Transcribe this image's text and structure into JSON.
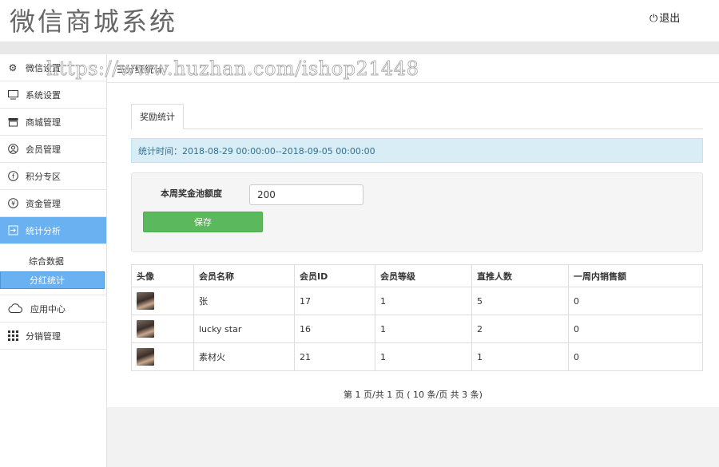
{
  "brand": "微信商城系统",
  "header": {
    "logout_label": "退出"
  },
  "sidebar": {
    "items": [
      {
        "label": "微信设置",
        "icon": "gear-icon"
      },
      {
        "label": "系统设置",
        "icon": "monitor-icon"
      },
      {
        "label": "商城管理",
        "icon": "store-icon"
      },
      {
        "label": "会员管理",
        "icon": "user-circle-icon"
      },
      {
        "label": "积分专区",
        "icon": "coin-icon"
      },
      {
        "label": "资金管理",
        "icon": "yen-icon"
      },
      {
        "label": "统计分析",
        "icon": "export-icon"
      }
    ],
    "subitems": [
      {
        "label": "综合数据"
      },
      {
        "label": "分红统计"
      }
    ],
    "extra": [
      {
        "label": "应用中心",
        "icon": "cloud-icon"
      },
      {
        "label": "分销管理",
        "icon": "grid-icon"
      }
    ]
  },
  "breadcrumb": "分红统计",
  "tabs": [
    {
      "label": "奖励统计"
    }
  ],
  "stat_time": "统计时间：2018-08-29 00:00:00--2018-09-05 00:00:00",
  "form": {
    "label": "本周奖金池额度",
    "value": "200",
    "save_label": "保存"
  },
  "table": {
    "headers": [
      "头像",
      "会员名称",
      "会员ID",
      "会员等级",
      "直推人数",
      "一周内销售额"
    ],
    "rows": [
      {
        "name": "张",
        "id": "17",
        "level": "1",
        "direct": "5",
        "sales": "0"
      },
      {
        "name": "lucky star",
        "id": "16",
        "level": "1",
        "direct": "2",
        "sales": "0"
      },
      {
        "name": "素材火",
        "id": "21",
        "level": "1",
        "direct": "1",
        "sales": "0"
      }
    ]
  },
  "pager": "第 1 页/共 1 页 ( 10 条/页 共 3 条)",
  "watermark": "https://www.huzhan.com/ishop21448",
  "colors": {
    "sidebar_active": "#6ab1f1",
    "save_button": "#5cb85c",
    "info_bg": "#d9edf7"
  }
}
